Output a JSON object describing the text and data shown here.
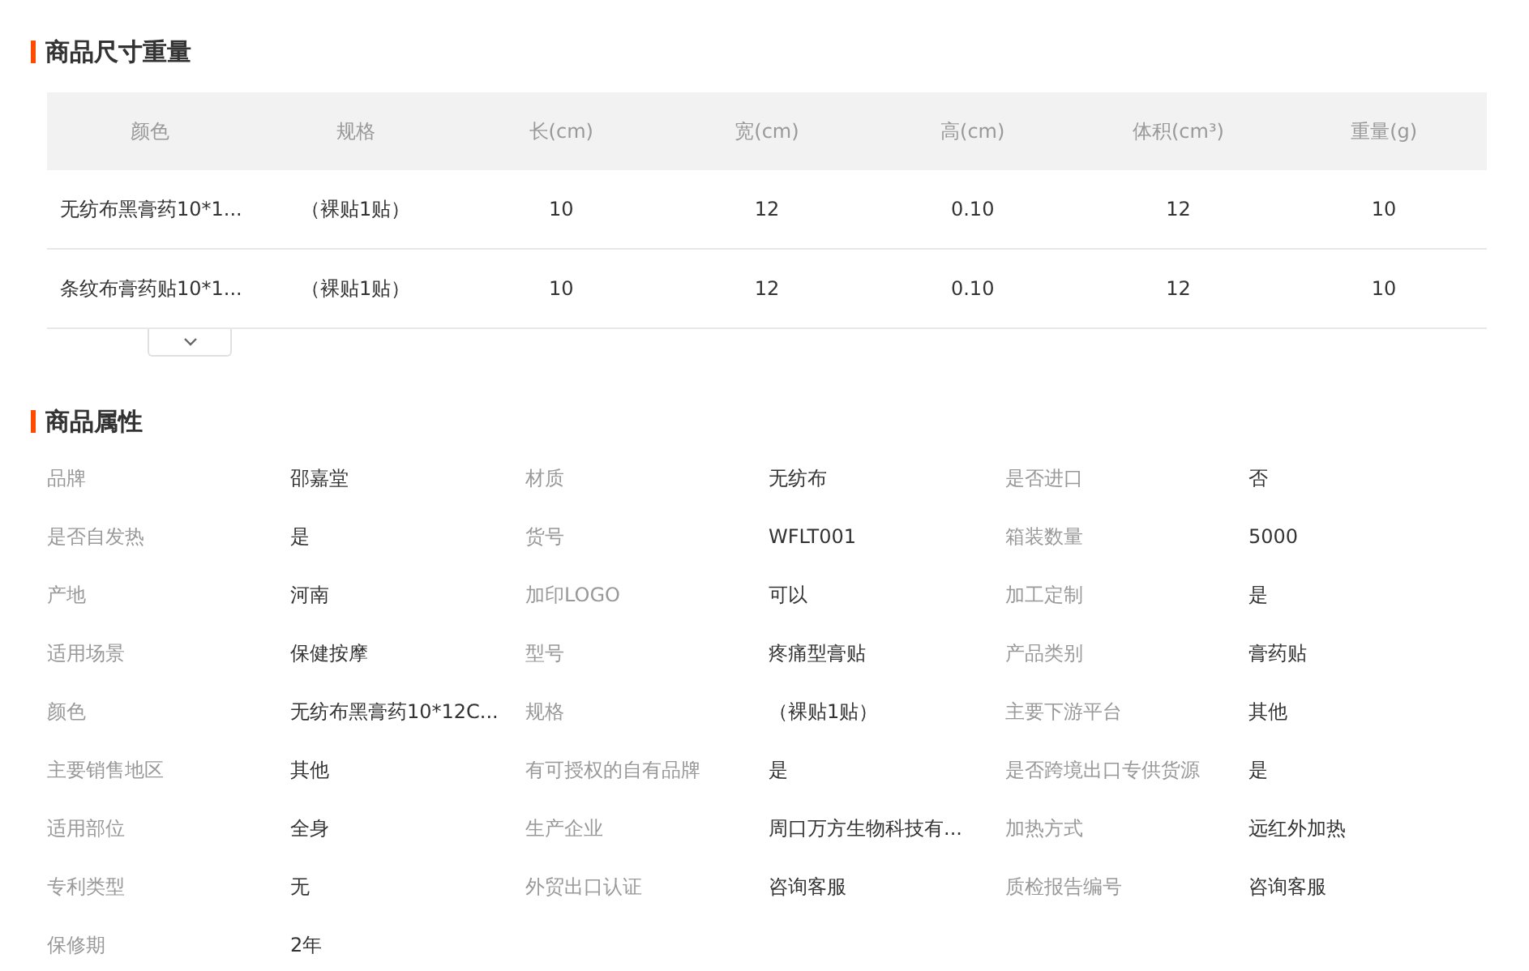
{
  "size_section": {
    "title": "商品尺寸重量",
    "table": {
      "columns": [
        "颜色",
        "规格",
        "长(cm)",
        "宽(cm)",
        "高(cm)",
        "体积(cm³)",
        "重量(g)"
      ],
      "rows": [
        [
          "无纺布黑膏药10*1...",
          "（裸贴1贴）",
          "10",
          "12",
          "0.10",
          "12",
          "10"
        ],
        [
          "条纹布膏药贴10*1...",
          "（裸贴1贴）",
          "10",
          "12",
          "0.10",
          "12",
          "10"
        ]
      ]
    }
  },
  "attributes_section": {
    "title": "商品属性",
    "attributes": [
      {
        "label": "品牌",
        "value": "邵嘉堂"
      },
      {
        "label": "材质",
        "value": "无纺布"
      },
      {
        "label": "是否进口",
        "value": "否"
      },
      {
        "label": "是否自发热",
        "value": "是"
      },
      {
        "label": "货号",
        "value": "WFLT001"
      },
      {
        "label": "箱装数量",
        "value": "5000"
      },
      {
        "label": "产地",
        "value": "河南"
      },
      {
        "label": "加印LOGO",
        "value": "可以"
      },
      {
        "label": "加工定制",
        "value": "是"
      },
      {
        "label": "适用场景",
        "value": "保健按摩"
      },
      {
        "label": "型号",
        "value": "疼痛型膏贴"
      },
      {
        "label": "产品类别",
        "value": "膏药贴"
      },
      {
        "label": "颜色",
        "value": "无纺布黑膏药10*12C..."
      },
      {
        "label": "规格",
        "value": "（裸贴1贴）"
      },
      {
        "label": "主要下游平台",
        "value": "其他"
      },
      {
        "label": "主要销售地区",
        "value": "其他"
      },
      {
        "label": "有可授权的自有品牌",
        "value": "是"
      },
      {
        "label": "是否跨境出口专供货源",
        "value": "是"
      },
      {
        "label": "适用部位",
        "value": "全身"
      },
      {
        "label": "生产企业",
        "value": "周口万方生物科技有..."
      },
      {
        "label": "加热方式",
        "value": "远红外加热"
      },
      {
        "label": "专利类型",
        "value": "无"
      },
      {
        "label": "外贸出口认证",
        "value": "咨询客服"
      },
      {
        "label": "质检报告编号",
        "value": "咨询客服"
      },
      {
        "label": "保修期",
        "value": "2年"
      }
    ]
  }
}
